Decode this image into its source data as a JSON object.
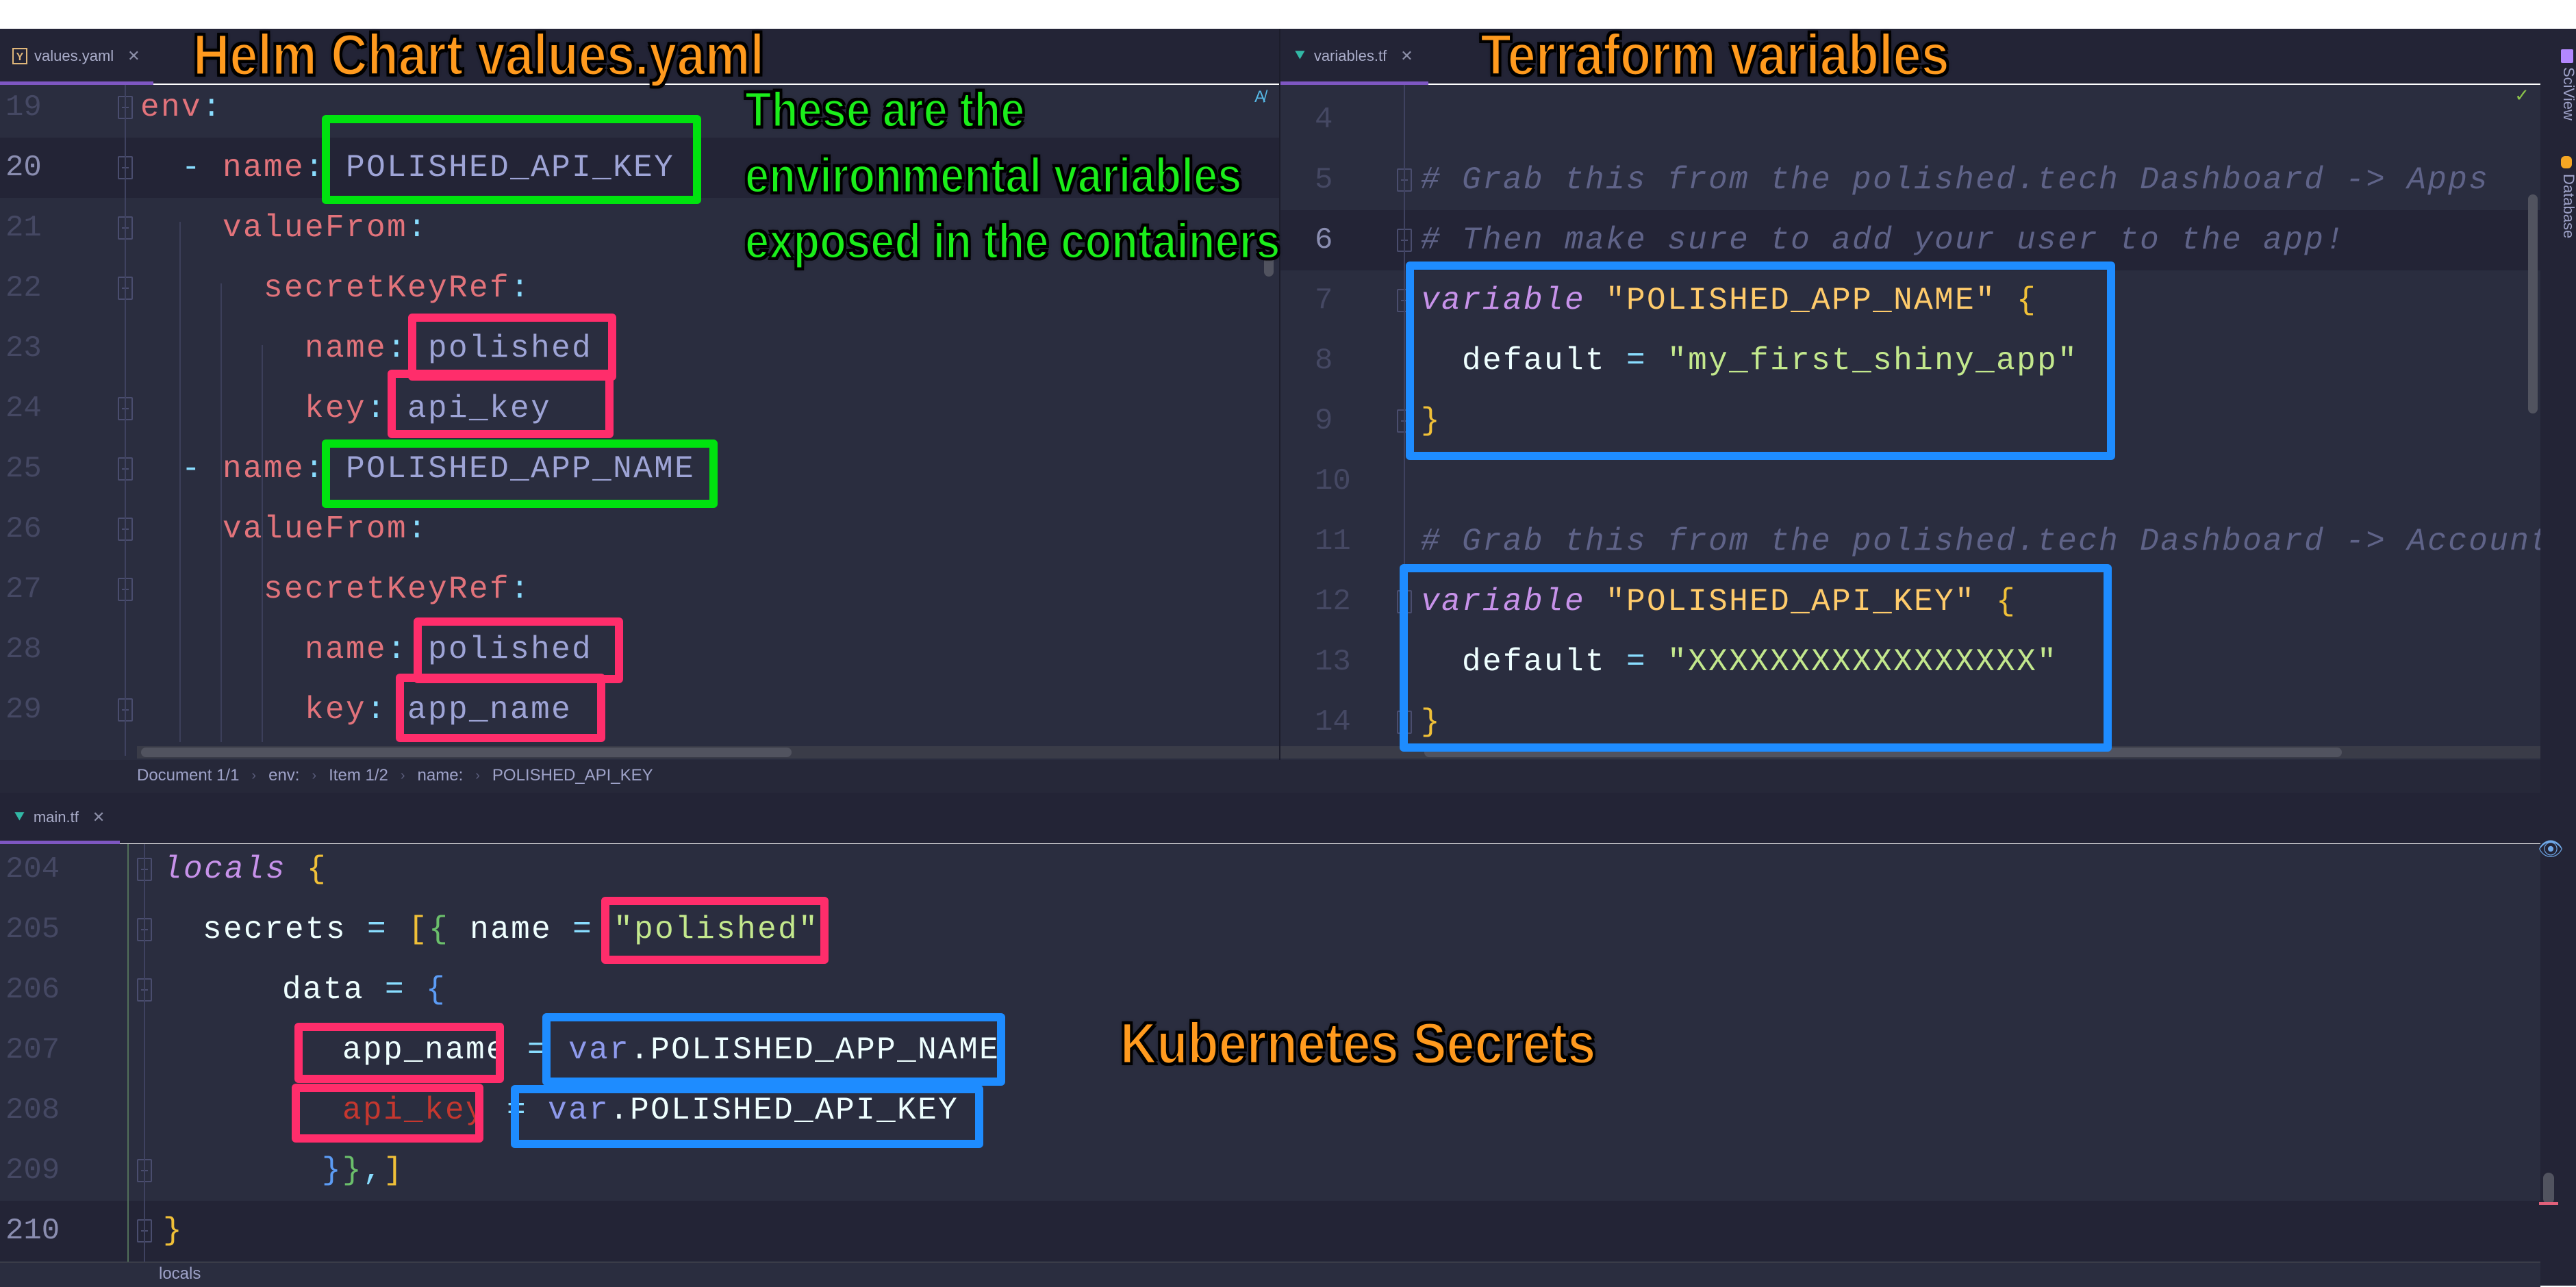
{
  "annotations": {
    "helm_title": "Helm Chart values.yaml",
    "terraform_title": "Terraform variables",
    "env_note_lines": [
      "These are the",
      "environmental variables",
      "exposed in the containers"
    ],
    "k8s_title": "Kubernetes Secrets"
  },
  "tabs": {
    "values": {
      "label": "values.yaml",
      "icon": "yaml-file-icon"
    },
    "variables": {
      "label": "variables.tf",
      "icon": "terraform-icon"
    },
    "main": {
      "label": "main.tf",
      "icon": "terraform-icon"
    }
  },
  "right_toolbar": {
    "sciview": "SciView",
    "database": "Database"
  },
  "yaml": {
    "lines": [
      {
        "n": "19",
        "indent": 0,
        "parts": [
          {
            "t": "env",
            "c": "k"
          },
          {
            "t": ":",
            "c": "p"
          }
        ]
      },
      {
        "n": "20",
        "indent": 1,
        "parts": [
          {
            "t": "- ",
            "c": "p"
          },
          {
            "t": "name",
            "c": "k"
          },
          {
            "t": ":",
            "c": "p"
          },
          {
            "t": " POLISHED_API_KEY",
            "c": "v"
          }
        ]
      },
      {
        "n": "21",
        "indent": 2,
        "parts": [
          {
            "t": "valueFrom",
            "c": "k"
          },
          {
            "t": ":",
            "c": "p"
          }
        ]
      },
      {
        "n": "22",
        "indent": 3,
        "parts": [
          {
            "t": "secretKeyRef",
            "c": "k"
          },
          {
            "t": ":",
            "c": "p"
          }
        ]
      },
      {
        "n": "23",
        "indent": 4,
        "parts": [
          {
            "t": "name",
            "c": "k"
          },
          {
            "t": ":",
            "c": "p"
          },
          {
            "t": " polished",
            "c": "v"
          }
        ]
      },
      {
        "n": "24",
        "indent": 4,
        "parts": [
          {
            "t": "key",
            "c": "k"
          },
          {
            "t": ":",
            "c": "p"
          },
          {
            "t": " api_key",
            "c": "v"
          }
        ]
      },
      {
        "n": "25",
        "indent": 1,
        "parts": [
          {
            "t": "- ",
            "c": "p"
          },
          {
            "t": "name",
            "c": "k"
          },
          {
            "t": ":",
            "c": "p"
          },
          {
            "t": " POLISHED_APP_NAME",
            "c": "v"
          }
        ]
      },
      {
        "n": "26",
        "indent": 2,
        "parts": [
          {
            "t": "valueFrom",
            "c": "k"
          },
          {
            "t": ":",
            "c": "p"
          }
        ]
      },
      {
        "n": "27",
        "indent": 3,
        "parts": [
          {
            "t": "secretKeyRef",
            "c": "k"
          },
          {
            "t": ":",
            "c": "p"
          }
        ]
      },
      {
        "n": "28",
        "indent": 4,
        "parts": [
          {
            "t": "name",
            "c": "k"
          },
          {
            "t": ":",
            "c": "p"
          },
          {
            "t": " polished",
            "c": "v"
          }
        ]
      },
      {
        "n": "29",
        "indent": 4,
        "parts": [
          {
            "t": "key",
            "c": "k"
          },
          {
            "t": ":",
            "c": "p"
          },
          {
            "t": " app_name",
            "c": "v"
          }
        ]
      }
    ],
    "current_line": "20",
    "breadcrumb": [
      "Document 1/1",
      "env:",
      "Item 1/2",
      "name:",
      "POLISHED_API_KEY"
    ]
  },
  "variables_tf": {
    "lines": [
      {
        "n": "4",
        "indent": 0,
        "parts": []
      },
      {
        "n": "5",
        "indent": 0,
        "parts": [
          {
            "t": "# Grab this from the polished.tech Dashboard -> Apps",
            "c": "cm"
          }
        ]
      },
      {
        "n": "6",
        "indent": 0,
        "parts": [
          {
            "t": "# Then make sure to add your user to the app!",
            "c": "cm"
          }
        ]
      },
      {
        "n": "7",
        "indent": 0,
        "parts": [
          {
            "t": "variable",
            "c": "kw"
          },
          {
            "t": " \"POLISHED_APP_NAME\" ",
            "c": "str"
          },
          {
            "t": "{",
            "c": "br-y"
          }
        ]
      },
      {
        "n": "8",
        "indent": 1,
        "parts": [
          {
            "t": "default",
            "c": "wh"
          },
          {
            "t": " = ",
            "c": "p"
          },
          {
            "t": "\"my_first_shiny_app\"",
            "c": "gs"
          }
        ]
      },
      {
        "n": "9",
        "indent": 0,
        "parts": [
          {
            "t": "}",
            "c": "br-y"
          }
        ]
      },
      {
        "n": "10",
        "indent": 0,
        "parts": []
      },
      {
        "n": "11",
        "indent": 0,
        "parts": [
          {
            "t": "# Grab this from the polished.tech Dashboard -> Account",
            "c": "cm"
          }
        ]
      },
      {
        "n": "12",
        "indent": 0,
        "parts": [
          {
            "t": "variable",
            "c": "kw"
          },
          {
            "t": " \"POLISHED_API_KEY\" ",
            "c": "str"
          },
          {
            "t": "{",
            "c": "br-y"
          }
        ]
      },
      {
        "n": "13",
        "indent": 1,
        "parts": [
          {
            "t": "default",
            "c": "wh"
          },
          {
            "t": " = ",
            "c": "p"
          },
          {
            "t": "\"XXXXXXXXXXXXXXXXX\"",
            "c": "gs"
          }
        ]
      },
      {
        "n": "14",
        "indent": 0,
        "parts": [
          {
            "t": "}",
            "c": "br-y"
          }
        ]
      }
    ]
  },
  "main_tf": {
    "lines": [
      {
        "n": "204",
        "indent": 0,
        "parts": [
          {
            "t": "locals",
            "c": "kw"
          },
          {
            "t": " ",
            "c": "wh"
          },
          {
            "t": "{",
            "c": "br-y"
          }
        ]
      },
      {
        "n": "205",
        "indent": 1,
        "parts": [
          {
            "t": "secrets",
            "c": "wh"
          },
          {
            "t": " = ",
            "c": "p"
          },
          {
            "t": "[",
            "c": "br-y"
          },
          {
            "t": "{",
            "c": "br-g"
          },
          {
            "t": " name",
            "c": "wh"
          },
          {
            "t": " = ",
            "c": "p"
          },
          {
            "t": "\"polished\"",
            "c": "gs"
          }
        ]
      },
      {
        "n": "206",
        "indent": 3,
        "parts": [
          {
            "t": "data",
            "c": "wh"
          },
          {
            "t": " = ",
            "c": "p"
          },
          {
            "t": "{",
            "c": "br-b"
          }
        ]
      },
      {
        "n": "207",
        "indent": 4,
        "parts": [
          {
            "t": " app_name",
            "c": "wh"
          },
          {
            "t": " = ",
            "c": "p"
          },
          {
            "t": "var",
            "c": "varb"
          },
          {
            "t": ".POLISHED_APP_NAME",
            "c": "wh"
          }
        ]
      },
      {
        "n": "208",
        "indent": 4,
        "parts": [
          {
            "t": " api_key",
            "c": "red"
          },
          {
            "t": " = ",
            "c": "p"
          },
          {
            "t": "var",
            "c": "varb"
          },
          {
            "t": ".POLISHED_API_KEY",
            "c": "wh"
          }
        ]
      },
      {
        "n": "209",
        "indent": 4,
        "parts": [
          {
            "t": "}",
            "c": "br-b"
          },
          {
            "t": "}",
            "c": "br-g"
          },
          {
            "t": ",",
            "c": "p"
          },
          {
            "t": "]",
            "c": "br-y"
          }
        ]
      },
      {
        "n": "210",
        "indent": 0,
        "parts": [
          {
            "t": "}",
            "c": "br-y"
          }
        ]
      }
    ],
    "current_line": "210",
    "breadcrumb": [
      "locals"
    ]
  },
  "colors": {
    "editor_bg": "#2a2d3f",
    "tab_accent": "#7e57c2",
    "highlight_green": "#00e30f",
    "highlight_pink": "#ff2d6b",
    "highlight_blue": "#1e8cff",
    "callout_orange": "#ff9a1e"
  }
}
